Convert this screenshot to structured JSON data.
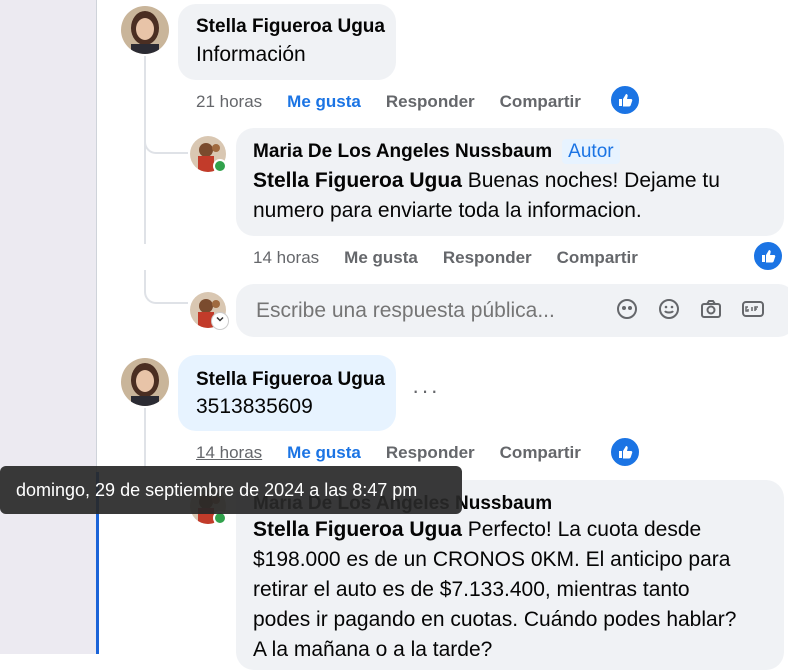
{
  "comments": [
    {
      "author": "Stella Figueroa Ugua",
      "text": "Información",
      "time": "21 horas",
      "like": "Me gusta",
      "reply": "Responder",
      "share": "Compartir"
    },
    {
      "author": "Stella Figueroa Ugua",
      "text": "3513835609",
      "time": "14 horas",
      "like": "Me gusta",
      "reply": "Responder",
      "share": "Compartir"
    }
  ],
  "replies": [
    {
      "author": "Maria De Los Angeles Nussbaum",
      "badge": "Autor",
      "mention": "Stella Figueroa Ugua",
      "text_line1": "Buenas noches! Dejame tu",
      "text_line2": "numero para enviarte toda la informacion.",
      "time": "14 horas",
      "like": "Me gusta",
      "reply": "Responder",
      "share": "Compartir"
    },
    {
      "author": "Maria De Los Angeles Nussbaum",
      "mention": "Stella Figueroa Ugua",
      "text_line1": "Perfecto! La cuota desde",
      "text_line2": "$198.000 es de un CRONOS 0KM. El anticipo para",
      "text_line3": "retirar el auto es de $7.133.400, mientras tanto",
      "text_line4": "podes ir pagando en cuotas. Cuándo podes hablar?",
      "text_line5": "A la mañana o a la tarde?"
    }
  ],
  "reply_box": {
    "placeholder": "Escribe una respuesta pública..."
  },
  "tooltip": "domingo, 29 de septiembre de 2024 a las 8:47 pm",
  "icons": {
    "like": "thumbs-up-icon",
    "avatar": "avatar-icon",
    "sticker": "avatar-sticker-icon",
    "emoji": "emoji-icon",
    "camera": "camera-icon",
    "gif": "gif-icon",
    "more": "more-dots-icon",
    "chevron": "chevron-down-icon"
  },
  "colors": {
    "accent": "#1b74e4",
    "bubble": "#f0f2f5",
    "bubble_selected": "#e7f3ff",
    "muted": "#65676b",
    "online": "#31a24c"
  }
}
